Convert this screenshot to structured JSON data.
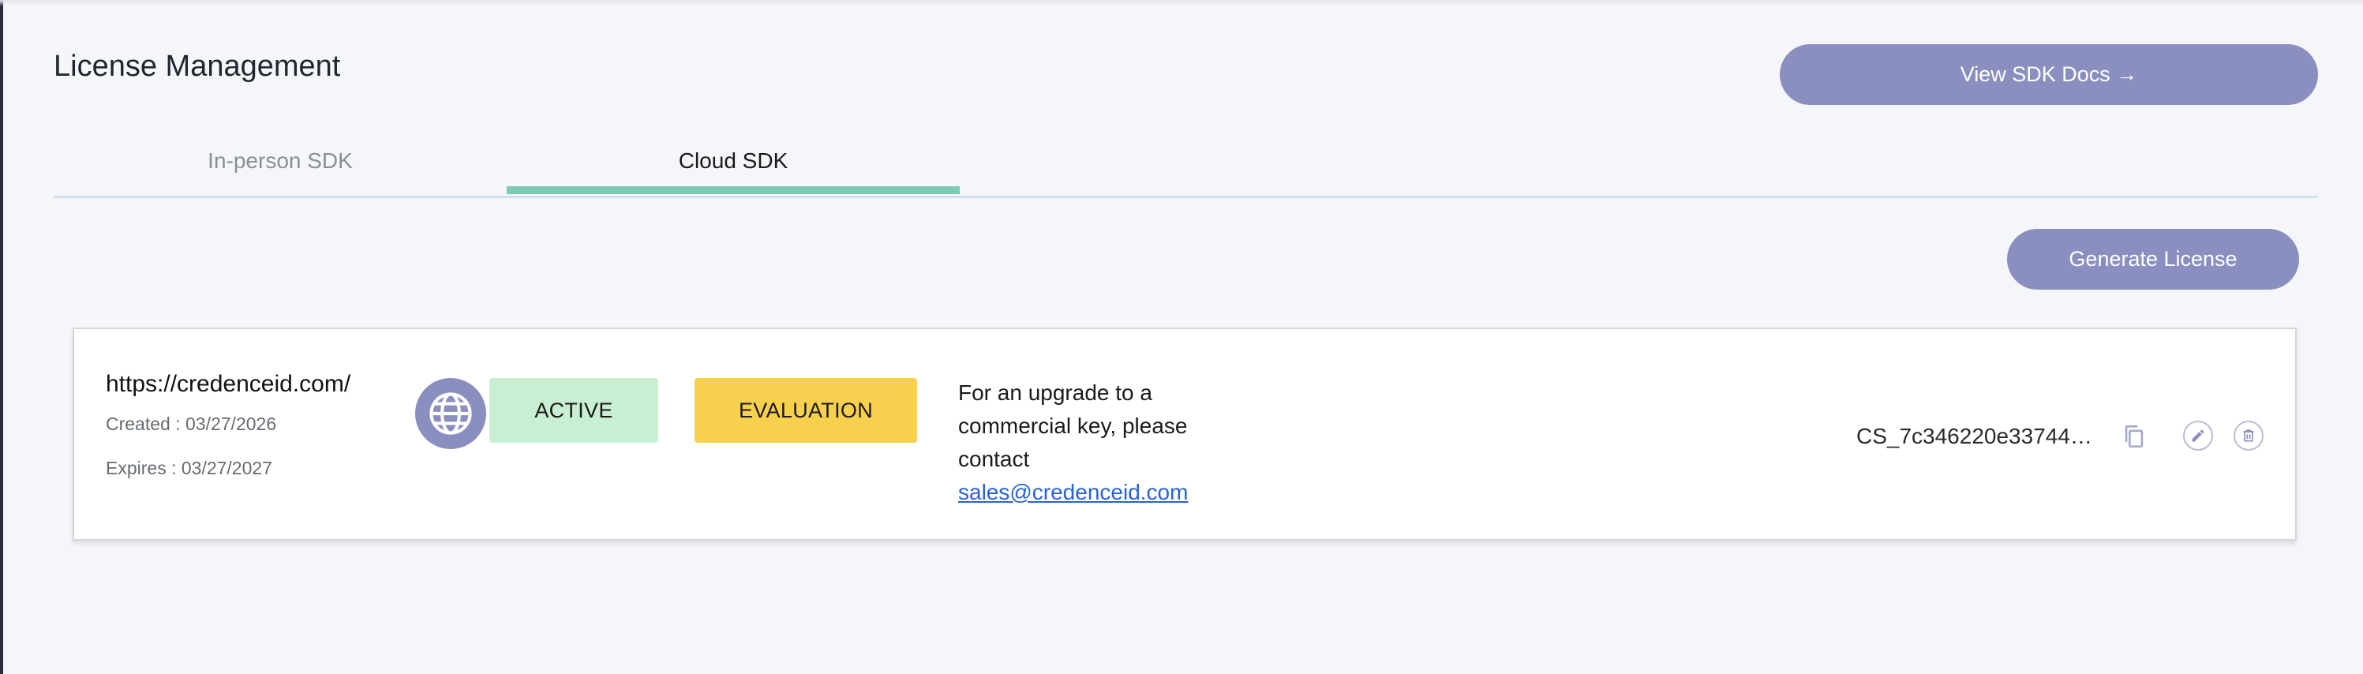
{
  "page": {
    "title": "License Management"
  },
  "header": {
    "docs_button_label": "View SDK Docs →"
  },
  "tabs": [
    {
      "label": "In-person SDK",
      "active": false
    },
    {
      "label": "Cloud SDK",
      "active": true
    }
  ],
  "actions": {
    "generate_label": "Generate License"
  },
  "license": {
    "domain": "https://credenceid.com/",
    "created": "Created : 03/27/2026",
    "expires": "Expires : 03/27/2027",
    "status": "ACTIVE",
    "type": "EVALUATION",
    "upgrade_text": "For an upgrade to a commercial key, please contact",
    "contact_email": "sales@credenceid.com",
    "key": "CS_7c346220e33744ae..."
  },
  "icons": {
    "domain": "globe-icon",
    "copy": "copy-icon",
    "edit": "pencil-icon",
    "delete": "trash-icon"
  },
  "colors": {
    "accent": "#8a8fbf",
    "tab_indicator": "#7ec8b8",
    "active_badge": "#c9efd2",
    "evaluation_badge": "#f7d04e",
    "link": "#2a62d6"
  }
}
